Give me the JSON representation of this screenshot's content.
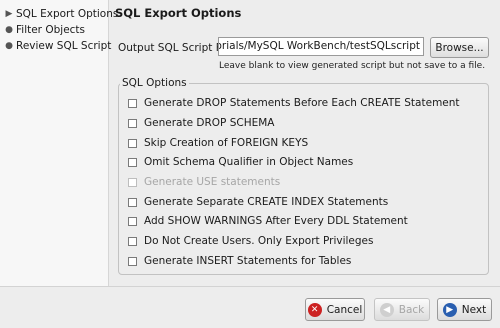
{
  "sidebar": {
    "steps": [
      {
        "label": "SQL Export Options",
        "active": true
      },
      {
        "label": "Filter Objects",
        "active": false
      },
      {
        "label": "Review SQL Script",
        "active": false
      }
    ]
  },
  "main": {
    "title": "SQL Export Options",
    "output_label": "Output SQL Script File:",
    "output_value": "nents/tutorials/MySQL WorkBench/testSQLscript",
    "browse_label": "Browse...",
    "hint": "Leave blank to view generated script but not save to a file.",
    "group_title": "SQL Options",
    "options": [
      {
        "label": "Generate DROP Statements Before Each CREATE Statement",
        "checked": false,
        "enabled": true
      },
      {
        "label": "Generate DROP SCHEMA",
        "checked": false,
        "enabled": true
      },
      {
        "label": "Skip Creation of FOREIGN KEYS",
        "checked": false,
        "enabled": true
      },
      {
        "label": "Omit Schema Qualifier in Object Names",
        "checked": false,
        "enabled": true
      },
      {
        "label": "Generate USE statements",
        "checked": false,
        "enabled": false
      },
      {
        "label": "Generate Separate CREATE INDEX Statements",
        "checked": false,
        "enabled": true
      },
      {
        "label": "Add SHOW WARNINGS After Every DDL Statement",
        "checked": false,
        "enabled": true
      },
      {
        "label": "Do Not Create Users. Only Export Privileges",
        "checked": false,
        "enabled": true
      },
      {
        "label": "Generate INSERT Statements for Tables",
        "checked": false,
        "enabled": true
      }
    ]
  },
  "footer": {
    "cancel_label": "Cancel",
    "back_label": "Back",
    "next_label": "Next",
    "cancel_icon": "cancel-icon",
    "back_icon": "back-arrow-icon",
    "next_icon": "next-arrow-icon",
    "cancel_color": "#cc2222",
    "next_color": "#2a5fb0"
  }
}
